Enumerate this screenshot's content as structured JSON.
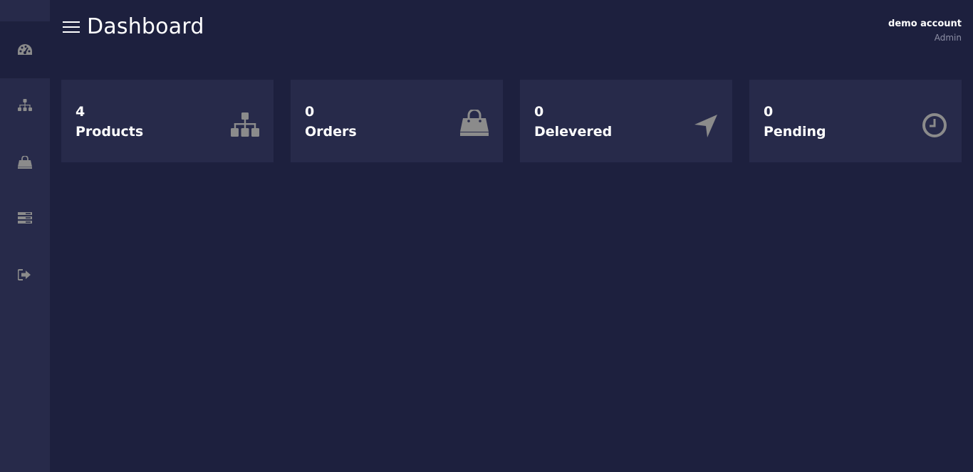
{
  "header": {
    "title": "Dashboard",
    "menu_icon": "hamburger-menu-icon"
  },
  "user": {
    "name": "demo account",
    "role": "Admin"
  },
  "sidebar": {
    "items": [
      {
        "icon": "dashboard-gauge-icon",
        "active": true
      },
      {
        "icon": "sitemap-icon",
        "active": false
      },
      {
        "icon": "shopping-bag-icon",
        "active": false
      },
      {
        "icon": "server-stack-icon",
        "active": false
      },
      {
        "icon": "sign-out-icon",
        "active": false
      }
    ]
  },
  "cards": [
    {
      "count": "4",
      "label": "Products",
      "icon": "sitemap-icon"
    },
    {
      "count": "0",
      "label": "Orders",
      "icon": "shopping-bag-icon"
    },
    {
      "count": "0",
      "label": "Delevered",
      "icon": "location-arrow-icon"
    },
    {
      "count": "0",
      "label": "Pending",
      "icon": "clock-icon"
    }
  ],
  "colors": {
    "background": "#1d203e",
    "panel": "#272a4a",
    "icon": "#8b8b8b",
    "text": "#ffffff",
    "muted": "#8e90a6"
  }
}
